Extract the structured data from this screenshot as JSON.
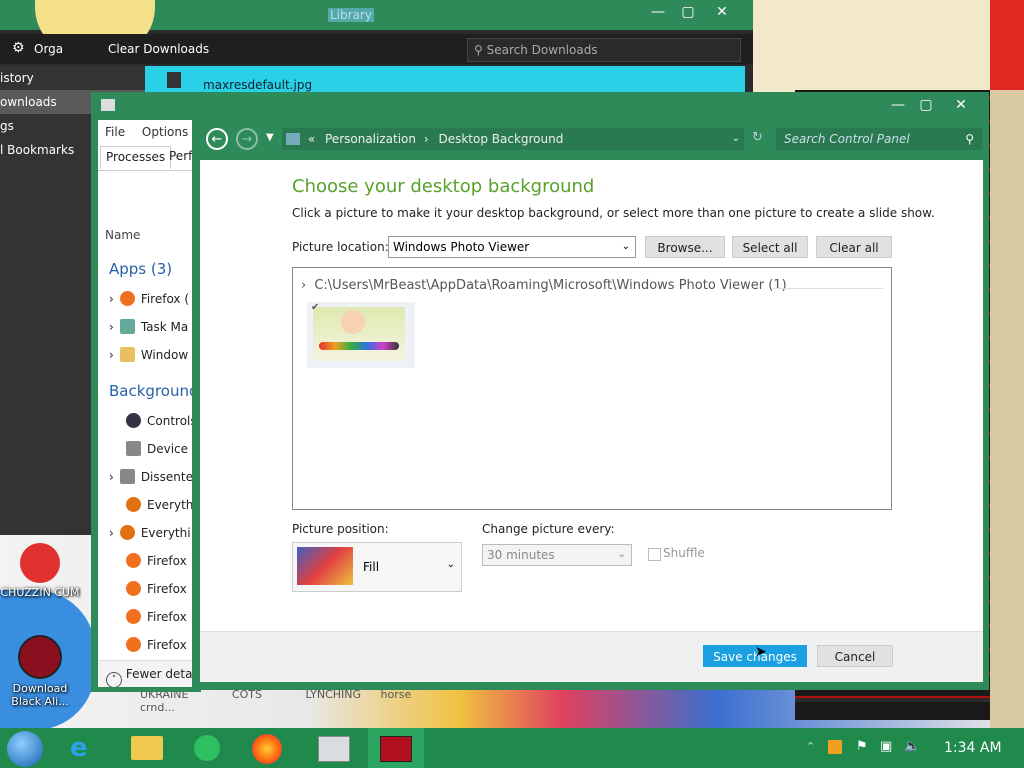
{
  "library": {
    "title": "Library",
    "organize_label": "Orga",
    "clear_label": "Clear Downloads",
    "search_placeholder": "Search Downloads",
    "sidebar": [
      "istory",
      "ownloads",
      "gs",
      "l Bookmarks"
    ],
    "download_item": "maxresdefault.jpg"
  },
  "taskmgr": {
    "menu": [
      "File",
      "Options"
    ],
    "tabs": [
      "Processes",
      "Perfo"
    ],
    "col_name": "Name",
    "apps_header": "Apps (3)",
    "apps": [
      "Firefox (",
      "Task Ma",
      "Window"
    ],
    "bg_header": "Background",
    "bg": [
      "Controls",
      "Device A",
      "Dissente",
      "Everythi",
      "Everythi",
      "Firefox",
      "Firefox",
      "Firefox",
      "Firefox"
    ],
    "fewer_label": "Fewer detai"
  },
  "cp": {
    "address": [
      "Personalization",
      "Desktop Background"
    ],
    "search_placeholder": "Search Control Panel",
    "heading": "Choose your desktop background",
    "description": "Click a picture to make it your desktop background, or select more than one picture to create a slide show.",
    "location_label": "Picture location:",
    "location_value": "Windows Photo Viewer",
    "browse_label": "Browse...",
    "select_all_label": "Select all",
    "clear_all_label": "Clear all",
    "folder_path": "C:\\Users\\MrBeast\\AppData\\Roaming\\Microsoft\\Windows Photo Viewer (1)",
    "position_label": "Picture position:",
    "position_value": "Fill",
    "change_label": "Change picture every:",
    "change_value": "30 minutes",
    "shuffle_label": "Shuffle",
    "save_label": "Save changes",
    "cancel_label": "Cancel"
  },
  "desktop": {
    "icon1_label": "CHUZZIN CUM",
    "icon2_label": "Download Black Ali...",
    "bottom_labels": [
      "UKRAINE",
      "COTS",
      "LYNCHING",
      "horse crnd..."
    ]
  },
  "taskbar": {
    "time": "1:34 AM"
  },
  "colors": {
    "window_accent": "#2f8a5a",
    "heading_green": "#5aa02c",
    "save_button": "#1ba1e2"
  }
}
